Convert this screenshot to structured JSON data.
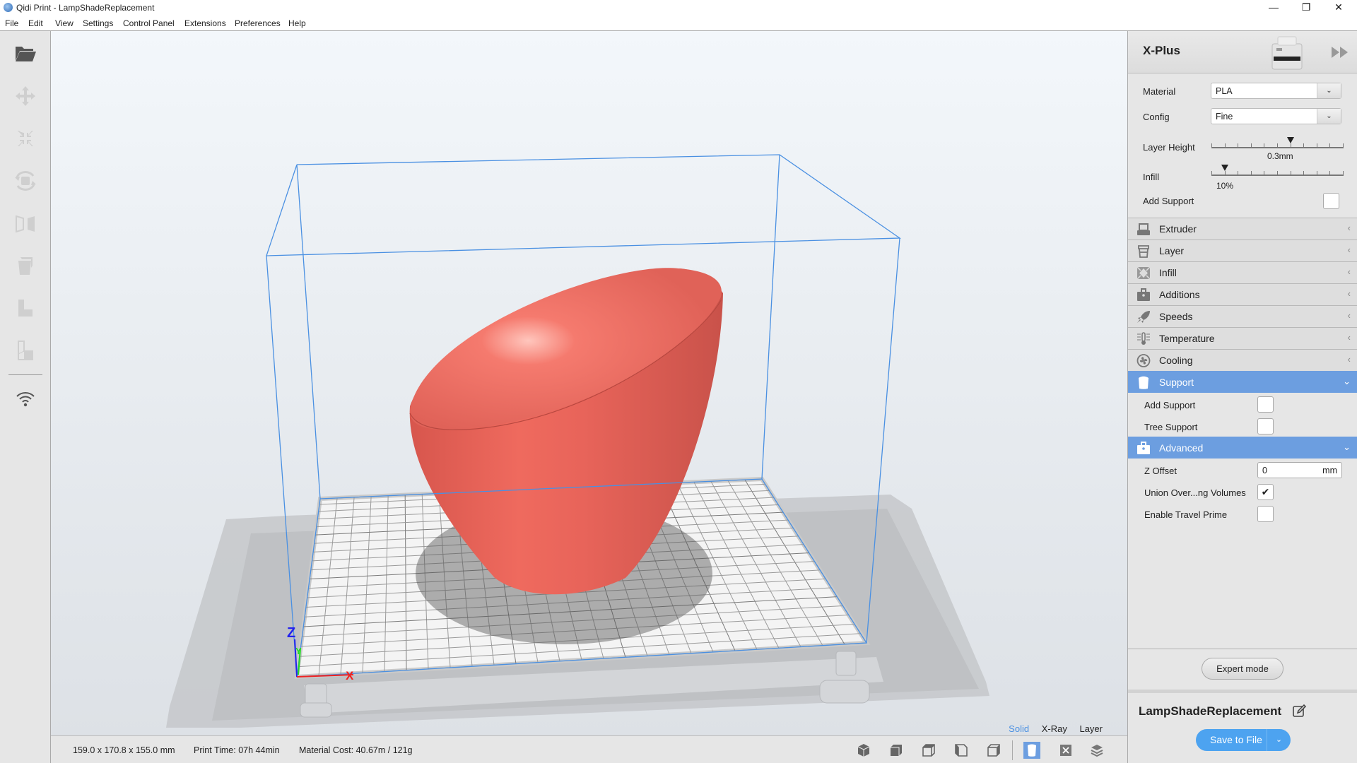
{
  "window": {
    "title": "Qidi Print - LampShadeReplacement",
    "controls": {
      "minimize": "—",
      "restore": "❐",
      "close": "✕"
    }
  },
  "menu": [
    "File",
    "Edit",
    "View",
    "Settings",
    "Control Panel",
    "Extensions",
    "Preferences",
    "Help"
  ],
  "toolbar": {
    "tools": [
      {
        "name": "open-folder",
        "enabled": true
      },
      {
        "name": "move",
        "enabled": false
      },
      {
        "name": "scale",
        "enabled": false
      },
      {
        "name": "rotate",
        "enabled": false
      },
      {
        "name": "mirror",
        "enabled": false
      },
      {
        "name": "per-model-settings",
        "enabled": false
      },
      {
        "name": "support-blocker",
        "enabled": false
      },
      {
        "name": "support-eraser",
        "enabled": false
      },
      {
        "name": "wifi",
        "enabled": true
      }
    ]
  },
  "viewport": {
    "model_color": "#e8645a",
    "build_volume_color": "#4a90e2",
    "axes": {
      "x": "X",
      "y": "Y",
      "z": "Z"
    },
    "view_modes": [
      {
        "label": "Solid",
        "active": true
      },
      {
        "label": "X-Ray",
        "active": false
      },
      {
        "label": "Layer",
        "active": false
      }
    ]
  },
  "status": {
    "dimensions": "159.0 x 170.8 x 155.0 mm",
    "print_time": "Print Time: 07h 44min",
    "material_cost": "Material Cost: 40.67m / 121g"
  },
  "camera_buttons": [
    "3d-view",
    "front-view",
    "top-view",
    "left-view",
    "right-view",
    "solid-view",
    "xray-view",
    "layer-view"
  ],
  "panel": {
    "printer": "X-Plus",
    "material": {
      "label": "Material",
      "value": "PLA"
    },
    "config": {
      "label": "Config",
      "value": "Fine"
    },
    "layer_height": {
      "label": "Layer Height",
      "value": "0.3mm",
      "position_fraction": 0.6
    },
    "infill": {
      "label": "Infill",
      "value": "10%",
      "position_fraction": 0.1
    },
    "add_support": {
      "label": "Add Support",
      "checked": false
    },
    "sections": [
      {
        "label": "Extruder",
        "icon": "extruder-icon",
        "open": false
      },
      {
        "label": "Layer",
        "icon": "layer-icon",
        "open": false
      },
      {
        "label": "Infill",
        "icon": "infill-icon",
        "open": false
      },
      {
        "label": "Additions",
        "icon": "additions-icon",
        "open": false
      },
      {
        "label": "Speeds",
        "icon": "speeds-icon",
        "open": false
      },
      {
        "label": "Temperature",
        "icon": "temperature-icon",
        "open": false
      },
      {
        "label": "Cooling",
        "icon": "cooling-icon",
        "open": false
      },
      {
        "label": "Support",
        "icon": "support-icon",
        "open": true
      },
      {
        "label": "Advanced",
        "icon": "advanced-icon",
        "open": true
      }
    ],
    "support_items": [
      {
        "label": "Add Support",
        "checked": false
      },
      {
        "label": "Tree Support",
        "checked": false
      }
    ],
    "advanced_items": {
      "z_offset": {
        "label": "Z Offset",
        "value": "0",
        "unit": "mm"
      },
      "union": {
        "label": "Union Over...ng Volumes",
        "checked": true
      },
      "travel_prime": {
        "label": "Enable Travel Prime",
        "checked": false
      }
    },
    "expert_mode": "Expert mode",
    "job_name": "LampShadeReplacement",
    "save_button": "Save to File"
  }
}
